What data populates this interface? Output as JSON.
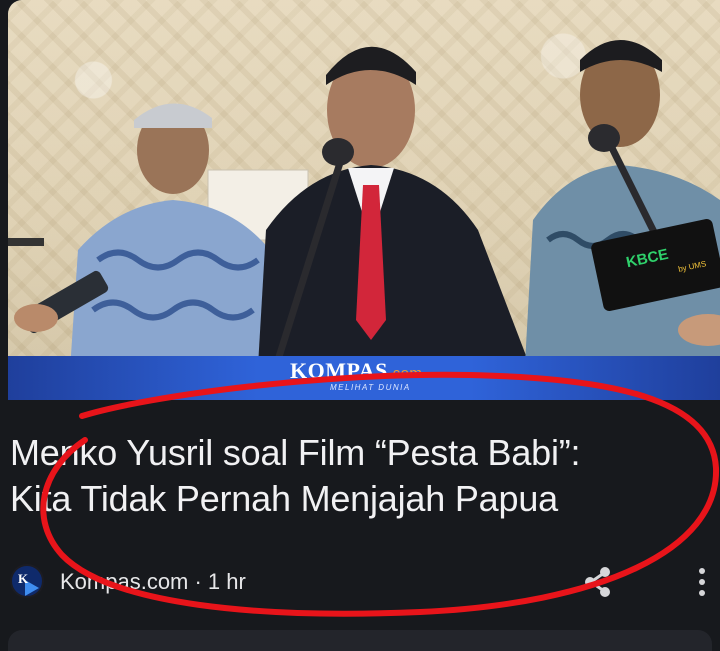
{
  "article": {
    "image_alt": "Press conference photo",
    "watermark": {
      "brand": "KOMPAS",
      "suffix": ".com",
      "tagline": "MELIHAT DUNIA"
    },
    "headline_line1": "Menko Yusril soal Film “Pesta Babi”:",
    "headline_line2": "Kita Tidak Pernah Menjajah Papua",
    "source_icon_letter": "K",
    "source_meta": "Kompas.com · 1 hr",
    "mic_flag_text": "KBCE",
    "mic_flag_sub": "by UMS"
  },
  "icons": {
    "share": "share-icon",
    "more": "more-vertical-icon"
  },
  "colors": {
    "background": "#17191d",
    "annotation": "#e8141a",
    "band": "#2f63d9",
    "text": "#f1f1f3"
  }
}
